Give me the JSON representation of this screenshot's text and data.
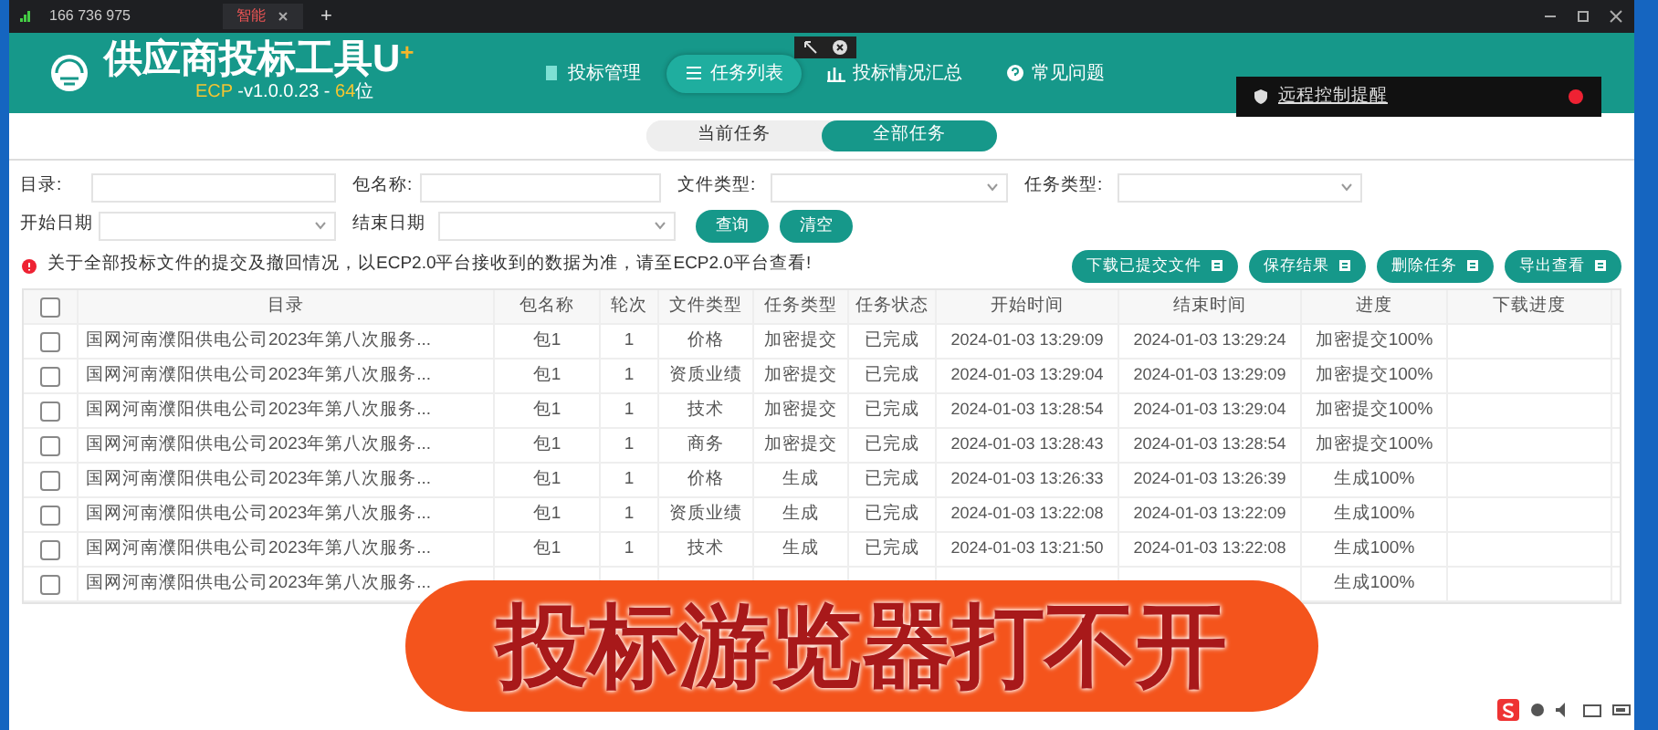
{
  "browser_bar": {
    "caller_id": "166 736 975",
    "tab": {
      "label": "智能",
      "selected": true
    },
    "new_tab": "+"
  },
  "app": {
    "title": "供应商投标工具U",
    "title_mark": "+",
    "version_prefix": "ECP",
    "version": " -v1.0.0.23 - ",
    "bits": "64",
    "bits_suffix": "位"
  },
  "nav": [
    {
      "label": "投标管理",
      "selected": false
    },
    {
      "label": "任务列表",
      "selected": true
    },
    {
      "label": "投标情况汇总",
      "selected": false
    },
    {
      "label": "常见问题",
      "selected": false
    }
  ],
  "notification": {
    "text": "远程控制提醒",
    "unread": true
  },
  "view_tabs": [
    {
      "label": "当前任务",
      "selected": false
    },
    {
      "label": "全部任务",
      "selected": true
    }
  ],
  "filter_rows": [
    [
      {
        "kind": "text",
        "label": "目录:"
      },
      {
        "kind": "text",
        "label": "包名称:"
      },
      {
        "kind": "select",
        "label": "文件类型:"
      },
      {
        "kind": "select",
        "label": "任务类型:"
      }
    ],
    [
      {
        "kind": "select",
        "label": "开始日期"
      },
      {
        "kind": "select",
        "label": "结束日期"
      },
      {
        "kind": "button",
        "label": "查询"
      },
      {
        "kind": "button",
        "label": "清空"
      }
    ]
  ],
  "notice": "关于全部投标文件的提交及撤回情况，以ECP2.0平台接收到的数据为准，请至ECP2.0平台查看!",
  "actions": [
    "下载已提交文件",
    "保存结果",
    "删除任务",
    "导出查看"
  ],
  "table": {
    "all_checked": false,
    "columns": [
      "目录",
      "包名称",
      "轮次",
      "文件类型",
      "任务类型",
      "任务状态",
      "开始时间",
      "结束时间",
      "进度",
      "下载进度"
    ],
    "rows": [
      {
        "checked": false,
        "cells": [
          "国网河南濮阳供电公司2023年第八次服务...",
          "包1",
          "1",
          "价格",
          "加密提交",
          "已完成",
          "2024-01-03 13:29:09",
          "2024-01-03 13:29:24",
          "加密提交100%",
          null
        ]
      },
      {
        "checked": false,
        "cells": [
          "国网河南濮阳供电公司2023年第八次服务...",
          "包1",
          "1",
          "资质业绩",
          "加密提交",
          "已完成",
          "2024-01-03 13:29:04",
          "2024-01-03 13:29:09",
          "加密提交100%",
          null
        ]
      },
      {
        "checked": false,
        "cells": [
          "国网河南濮阳供电公司2023年第八次服务...",
          "包1",
          "1",
          "技术",
          "加密提交",
          "已完成",
          "2024-01-03 13:28:54",
          "2024-01-03 13:29:04",
          "加密提交100%",
          null
        ]
      },
      {
        "checked": false,
        "cells": [
          "国网河南濮阳供电公司2023年第八次服务...",
          "包1",
          "1",
          "商务",
          "加密提交",
          "已完成",
          "2024-01-03 13:28:43",
          "2024-01-03 13:28:54",
          "加密提交100%",
          null
        ]
      },
      {
        "checked": false,
        "cells": [
          "国网河南濮阳供电公司2023年第八次服务...",
          "包1",
          "1",
          "价格",
          "生成",
          "已完成",
          "2024-01-03 13:26:33",
          "2024-01-03 13:26:39",
          "生成100%",
          null
        ]
      },
      {
        "checked": false,
        "cells": [
          "国网河南濮阳供电公司2023年第八次服务...",
          "包1",
          "1",
          "资质业绩",
          "生成",
          "已完成",
          "2024-01-03 13:22:08",
          "2024-01-03 13:22:09",
          "生成100%",
          null
        ]
      },
      {
        "checked": false,
        "cells": [
          "国网河南濮阳供电公司2023年第八次服务...",
          "包1",
          "1",
          "技术",
          "生成",
          "已完成",
          "2024-01-03 13:21:50",
          "2024-01-03 13:22:08",
          "生成100%",
          null
        ]
      },
      {
        "checked": false,
        "cells": [
          "国网河南濮阳供电公司2023年第八次服务...",
          null,
          null,
          null,
          null,
          null,
          null,
          null,
          "生成100%",
          null
        ]
      }
    ]
  },
  "overlay_caption": "投标游览器打不开"
}
